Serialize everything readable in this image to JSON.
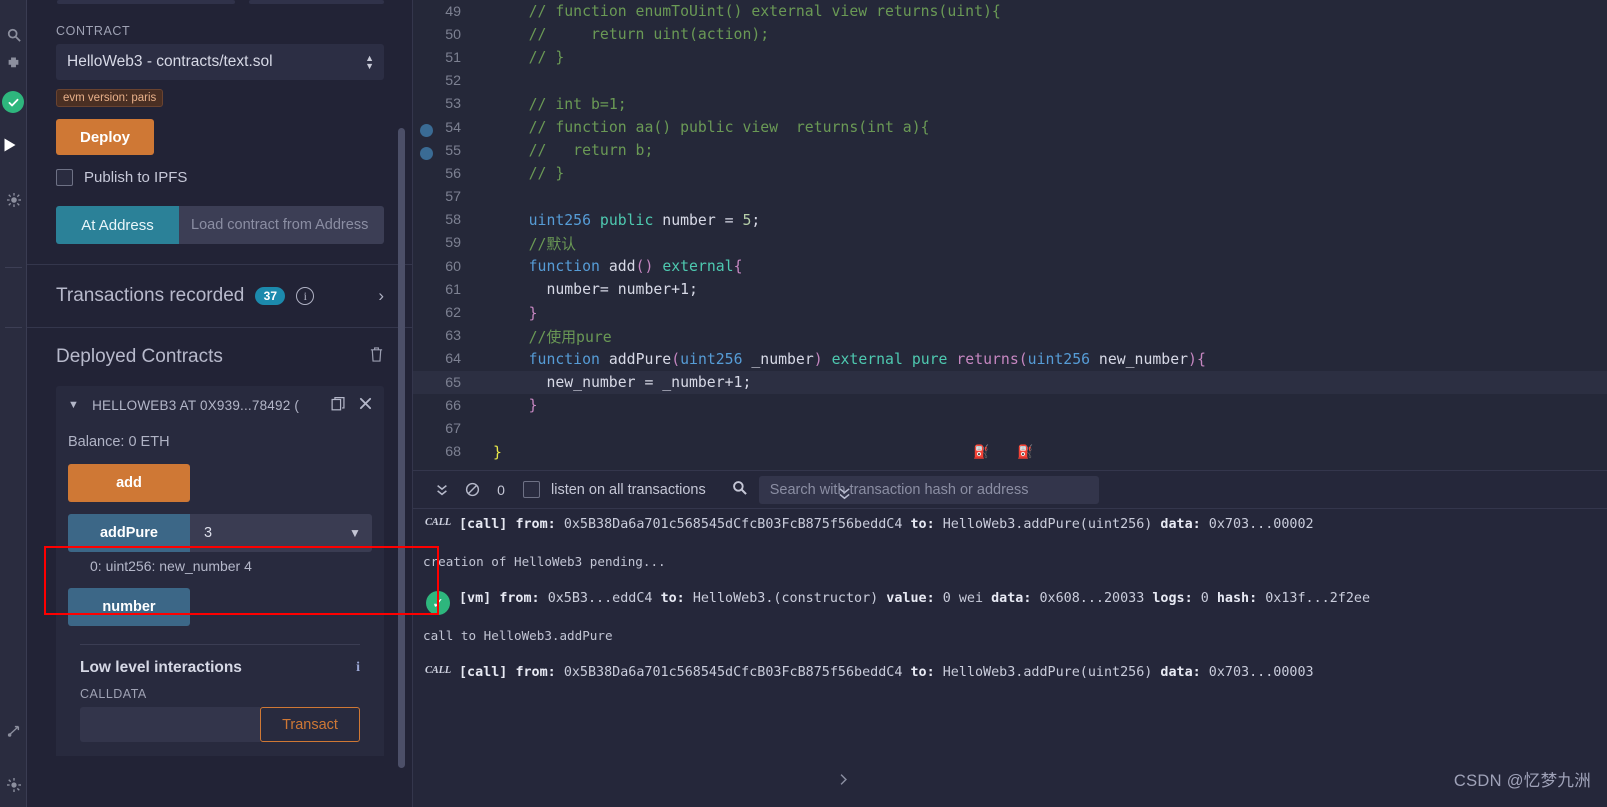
{
  "icon_rail": {
    "items": [
      {
        "name": "search-icon",
        "glyph": "⌕"
      },
      {
        "name": "plugin-icon",
        "glyph": "❖"
      },
      {
        "name": "solidity-compiler-status-icon",
        "glyph": "✓"
      },
      {
        "name": "deploy-run-icon",
        "glyph": "▶"
      },
      {
        "name": "debugger-icon",
        "glyph": "✻"
      },
      {
        "name": "git-icon",
        "glyph": "⎇"
      },
      {
        "name": "settings-icon",
        "glyph": "⚙"
      }
    ]
  },
  "deploy_panel": {
    "contract_label": "CONTRACT",
    "contract_value": "HelloWeb3 - contracts/text.sol",
    "evm_badge": "evm version: paris",
    "deploy_button": "Deploy",
    "publish_ipfs_label": "Publish to IPFS",
    "at_address_button": "At Address",
    "at_address_placeholder": "Load contract from Address",
    "transactions_recorded_label": "Transactions recorded",
    "transactions_recorded_count": "37",
    "deployed_contracts_title": "Deployed Contracts",
    "contract_instance": {
      "title": "HELLOWEB3 AT 0X939...78492 (",
      "balance": "Balance: 0 ETH",
      "functions": [
        {
          "name": "add",
          "style": "orange",
          "input": null,
          "result": null
        },
        {
          "name": "addPure",
          "style": "blue",
          "input": "3",
          "result": "0: uint256: new_number 4"
        },
        {
          "name": "number",
          "style": "blue",
          "input": null,
          "result": null
        }
      ]
    },
    "low_level": {
      "title": "Low level interactions",
      "calldata_label": "CALLDATA",
      "calldata_value": "",
      "transact_button": "Transact"
    }
  },
  "editor": {
    "active_line": 65,
    "breakpoint_lines": [
      54,
      55
    ],
    "lines": [
      {
        "n": 49,
        "tokens": [
          {
            "t": "    ",
            "c": "pl"
          },
          {
            "t": "// function enumToUint() external view returns(uint){",
            "c": "cm"
          }
        ]
      },
      {
        "n": 50,
        "tokens": [
          {
            "t": "    ",
            "c": "pl"
          },
          {
            "t": "//     return uint(action);",
            "c": "cm"
          }
        ]
      },
      {
        "n": 51,
        "tokens": [
          {
            "t": "    ",
            "c": "pl"
          },
          {
            "t": "// }",
            "c": "cm"
          }
        ]
      },
      {
        "n": 52,
        "tokens": []
      },
      {
        "n": 53,
        "tokens": [
          {
            "t": "    ",
            "c": "pl"
          },
          {
            "t": "// int b=1;",
            "c": "cm"
          }
        ]
      },
      {
        "n": 54,
        "tokens": [
          {
            "t": "    ",
            "c": "pl"
          },
          {
            "t": "// function aa() public view  returns(int a){",
            "c": "cm"
          }
        ]
      },
      {
        "n": 55,
        "tokens": [
          {
            "t": "    ",
            "c": "pl"
          },
          {
            "t": "//   return b;",
            "c": "cm"
          }
        ]
      },
      {
        "n": 56,
        "tokens": [
          {
            "t": "    ",
            "c": "pl"
          },
          {
            "t": "// }",
            "c": "cm"
          }
        ]
      },
      {
        "n": 57,
        "tokens": []
      },
      {
        "n": 58,
        "tokens": [
          {
            "t": "    ",
            "c": "pl"
          },
          {
            "t": "uint256",
            "c": "kw"
          },
          {
            "t": " ",
            "c": "pl"
          },
          {
            "t": "public",
            "c": "ty"
          },
          {
            "t": " ",
            "c": "pl"
          },
          {
            "t": "number",
            "c": "pl"
          },
          {
            "t": " = ",
            "c": "pl"
          },
          {
            "t": "5",
            "c": "nu"
          },
          {
            "t": ";",
            "c": "pl"
          }
        ]
      },
      {
        "n": 59,
        "tokens": [
          {
            "t": "    ",
            "c": "pl"
          },
          {
            "t": "//默认",
            "c": "cm"
          }
        ]
      },
      {
        "n": 60,
        "tokens": [
          {
            "t": "    ",
            "c": "pl"
          },
          {
            "t": "function",
            "c": "kw"
          },
          {
            "t": " ",
            "c": "pl"
          },
          {
            "t": "add",
            "c": "pl"
          },
          {
            "t": "()",
            "c": "kw2"
          },
          {
            "t": " ",
            "c": "pl"
          },
          {
            "t": "external",
            "c": "ty"
          },
          {
            "t": "{",
            "c": "kw2"
          }
        ]
      },
      {
        "n": 61,
        "tokens": [
          {
            "t": "      ",
            "c": "pl"
          },
          {
            "t": "number= number+1;",
            "c": "pl"
          }
        ]
      },
      {
        "n": 62,
        "tokens": [
          {
            "t": "    ",
            "c": "pl"
          },
          {
            "t": "}",
            "c": "kw2"
          }
        ]
      },
      {
        "n": 63,
        "tokens": [
          {
            "t": "    ",
            "c": "pl"
          },
          {
            "t": "//使用pure",
            "c": "cm"
          }
        ]
      },
      {
        "n": 64,
        "tokens": [
          {
            "t": "    ",
            "c": "pl"
          },
          {
            "t": "function",
            "c": "kw"
          },
          {
            "t": " ",
            "c": "pl"
          },
          {
            "t": "addPure",
            "c": "pl"
          },
          {
            "t": "(",
            "c": "kw2"
          },
          {
            "t": "uint256",
            "c": "kw"
          },
          {
            "t": " _number",
            "c": "pl"
          },
          {
            "t": ")",
            "c": "kw2"
          },
          {
            "t": " ",
            "c": "pl"
          },
          {
            "t": "external",
            "c": "ty"
          },
          {
            "t": " ",
            "c": "pl"
          },
          {
            "t": "pure",
            "c": "ty"
          },
          {
            "t": " ",
            "c": "pl"
          },
          {
            "t": "returns",
            "c": "kw2"
          },
          {
            "t": "(",
            "c": "kw2"
          },
          {
            "t": "uint256",
            "c": "kw"
          },
          {
            "t": " new_number",
            "c": "pl"
          },
          {
            "t": ")",
            "c": "kw2"
          },
          {
            "t": "{",
            "c": "kw2"
          }
        ]
      },
      {
        "n": 65,
        "tokens": [
          {
            "t": "      ",
            "c": "pl"
          },
          {
            "t": "new_number = _number+1;",
            "c": "pl"
          }
        ]
      },
      {
        "n": 66,
        "tokens": [
          {
            "t": "    ",
            "c": "pl"
          },
          {
            "t": "}",
            "c": "kw2"
          }
        ]
      },
      {
        "n": 67,
        "tokens": []
      },
      {
        "n": 68,
        "tokens": [
          {
            "t": "}",
            "c": "brace-y"
          }
        ]
      }
    ]
  },
  "terminal": {
    "pending_count": "0",
    "listen_label": "listen on all transactions",
    "search_placeholder": "Search with transaction hash or address",
    "logs": [
      {
        "icon": "call",
        "badge": "CALL",
        "segments": [
          {
            "t": "[call] ",
            "bold": true
          },
          {
            "t": "from: ",
            "bold": true
          },
          {
            "t": "0x5B38Da6a701c568545dCfcB03FcB875f56beddC4 ",
            "bold": false
          },
          {
            "t": "to: ",
            "bold": true
          },
          {
            "t": "HelloWeb3.addPure(uint256) ",
            "bold": false
          },
          {
            "t": "data: ",
            "bold": true
          },
          {
            "t": "0x703...00002",
            "bold": false
          }
        ],
        "sub": "creation of HelloWeb3 pending..."
      },
      {
        "icon": "ok",
        "badge": "",
        "segments": [
          {
            "t": "[vm] ",
            "bold": true
          },
          {
            "t": "from: ",
            "bold": true
          },
          {
            "t": "0x5B3...eddC4 ",
            "bold": false
          },
          {
            "t": "to: ",
            "bold": true
          },
          {
            "t": "HelloWeb3.(constructor) ",
            "bold": false
          },
          {
            "t": "value: ",
            "bold": true
          },
          {
            "t": "0 wei ",
            "bold": false
          },
          {
            "t": "data: ",
            "bold": true
          },
          {
            "t": "0x608...20033 ",
            "bold": false
          },
          {
            "t": "logs: ",
            "bold": true
          },
          {
            "t": "0 ",
            "bold": false
          },
          {
            "t": "hash: ",
            "bold": true
          },
          {
            "t": "0x13f...2f2ee",
            "bold": false
          }
        ],
        "sub": "call to HelloWeb3.addPure"
      },
      {
        "icon": "call",
        "badge": "CALL",
        "segments": [
          {
            "t": "[call] ",
            "bold": true
          },
          {
            "t": "from: ",
            "bold": true
          },
          {
            "t": "0x5B38Da6a701c568545dCfcB03FcB875f56beddC4 ",
            "bold": false
          },
          {
            "t": "to: ",
            "bold": true
          },
          {
            "t": "HelloWeb3.addPure(uint256) ",
            "bold": false
          },
          {
            "t": "data: ",
            "bold": true
          },
          {
            "t": "0x703...00003",
            "bold": false
          }
        ],
        "sub": ""
      }
    ]
  },
  "watermark": "CSDN @忆梦九洲",
  "colors": {
    "accent_orange": "#cf7835",
    "accent_blue": "#3c6787",
    "teal": "#2b8198",
    "success_green": "#2eb67d",
    "highlight_red": "#fe0000",
    "panel_bg": "#222336",
    "editor_bg": "#252839"
  }
}
